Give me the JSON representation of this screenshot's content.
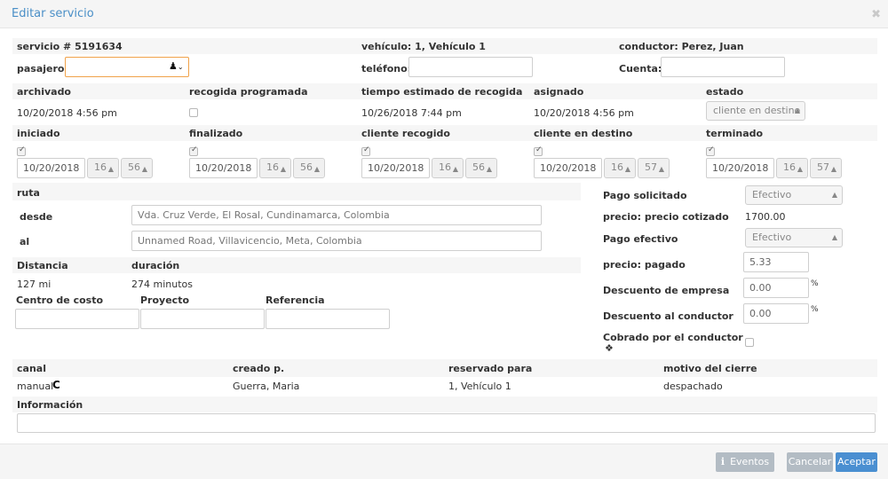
{
  "dialog": {
    "title": "Editar servicio",
    "close_icon": "✖"
  },
  "service": {
    "number_label": "servicio # 5191634",
    "vehicle_label": "vehículo: 1, Vehículo 1",
    "driver_label": "conductor: Perez, Juan"
  },
  "passenger": {
    "label": "pasajero:",
    "value": "",
    "icon": "user-icon"
  },
  "phone": {
    "label": "teléfono:",
    "value": ""
  },
  "account": {
    "label": "Cuenta:",
    "value": ""
  },
  "status_row": {
    "archived": {
      "label": "archivado",
      "value": "10/20/2018 4:56 pm"
    },
    "scheduled_pickup": {
      "label": "recogida programada",
      "checked": false
    },
    "estimated_pickup": {
      "label": "tiempo estimado de recogida",
      "value": "10/26/2018 7:44 pm"
    },
    "assigned": {
      "label": "asignado",
      "value": "10/20/2018 4:56 pm"
    },
    "state": {
      "label": "estado",
      "value": "cliente en destino"
    }
  },
  "time_fields": [
    {
      "label": "iniciado",
      "date": "10/20/2018",
      "hour": "16",
      "minute": "56",
      "checked": true
    },
    {
      "label": "finalizado",
      "date": "10/20/2018",
      "hour": "16",
      "minute": "56",
      "checked": true
    },
    {
      "label": "cliente recogido",
      "date": "10/20/2018",
      "hour": "16",
      "minute": "56",
      "checked": true
    },
    {
      "label": "cliente en destino",
      "date": "10/20/2018",
      "hour": "16",
      "minute": "57",
      "checked": true
    },
    {
      "label": "terminado",
      "date": "10/20/2018",
      "hour": "16",
      "minute": "57",
      "checked": true
    }
  ],
  "route": {
    "label": "ruta",
    "from_label": "desde",
    "from_value": "Vda. Cruz Verde, El Rosal, Cundinamarca, Colombia",
    "to_label": "al",
    "to_value": "Unnamed Road, Villavicencio, Meta, Colombia",
    "distance_label": "Distancia",
    "distance_value": "127 mi",
    "duration_label": "duración",
    "duration_value": "274 minutos"
  },
  "cost": {
    "cost_center_label": "Centro de costo",
    "project_label": "Proyecto",
    "reference_label": "Referencia"
  },
  "payment": {
    "requested_label": "Pago solicitado",
    "requested_value": "Efectivo",
    "quoted_label": "precio: precio cotizado",
    "quoted_value": "1700.00",
    "effective_label": "Pago efectivo",
    "effective_value": "Efectivo",
    "paid_label": "precio: pagado",
    "paid_value": "5.33",
    "company_discount_label": "Descuento de empresa",
    "company_discount_value": "0.00",
    "driver_discount_label": "Descuento al conductor",
    "driver_discount_value": "0.00",
    "percent": "%",
    "collected_label": "Cobrado por el conductor",
    "collected_icon": "money-icon",
    "collected_checked": false
  },
  "meta": {
    "channel_label": "canal",
    "channel_value": "manual",
    "channel_icon": "app-icon",
    "created_label": "creado p.",
    "created_value": "Guerra, Maria",
    "reserved_label": "reservado para",
    "reserved_value": "1, Vehículo 1",
    "close_reason_label": "motivo del cierre",
    "close_reason_value": "despachado"
  },
  "info": {
    "label": "Información",
    "value": ""
  },
  "footer": {
    "events_label": "Eventos",
    "events_icon": "info-icon",
    "cancel_label": "Cancelar",
    "accept_label": "Aceptar"
  },
  "colors": {
    "accent": "#4a8fd1",
    "title": "#4a8fc7",
    "input_focus": "#f0a24a",
    "disabled_button": "#b3bcc4"
  }
}
